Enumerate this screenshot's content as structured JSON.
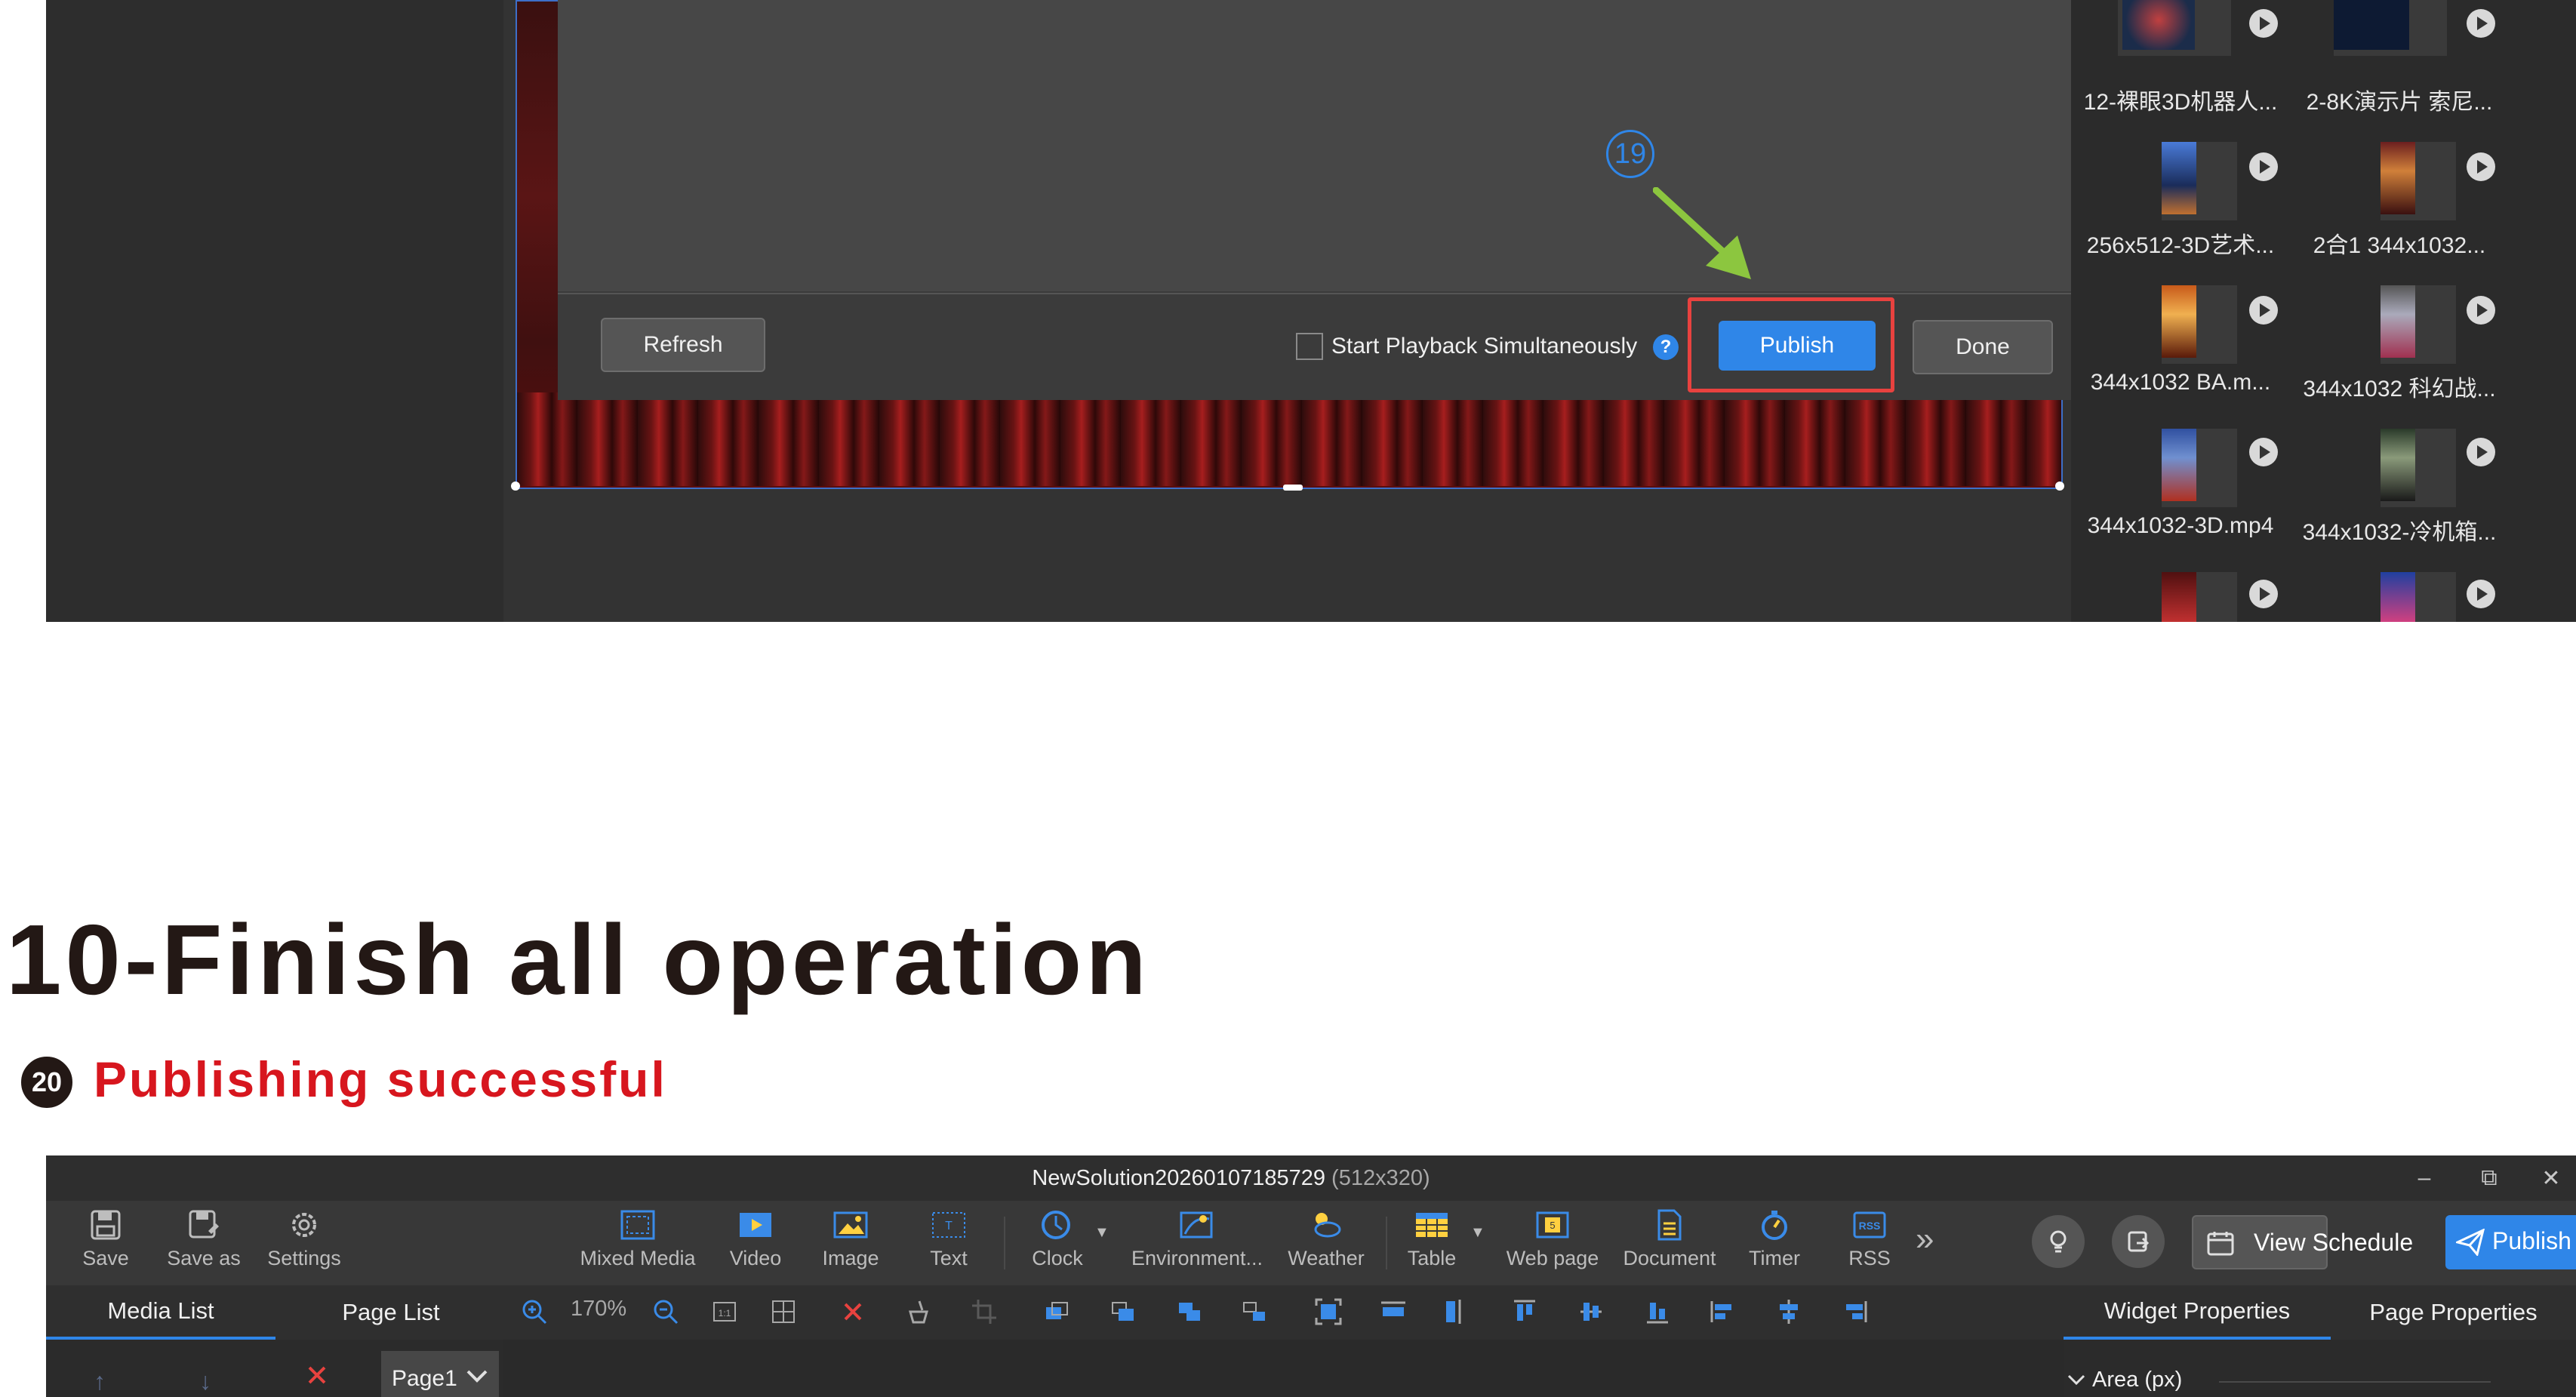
{
  "top_dialog": {
    "refresh_label": "Refresh",
    "start_playback_label": "Start Playback Simultaneously",
    "help_glyph": "?",
    "publish_label": "Publish",
    "done_label": "Done",
    "step_number": "19"
  },
  "media_grid": [
    {
      "caption": "12-裸眼3D机器人..."
    },
    {
      "caption": "2-8K演示片 索尼..."
    },
    {
      "caption": "256x512-3D艺术..."
    },
    {
      "caption": "2合1 344x1032..."
    },
    {
      "caption": "344x1032   BA.m..."
    },
    {
      "caption": "344x1032 科幻战..."
    },
    {
      "caption": "344x1032-3D.mp4"
    },
    {
      "caption": "344x1032-冷机箱..."
    }
  ],
  "heading": "10-Finish all operation",
  "step20": {
    "number": "20",
    "title": "Publishing successful"
  },
  "app": {
    "title": "NewSolution20260107185729",
    "resolution": "(512x320)",
    "window_controls": {
      "minimize": "–",
      "restore": "⧉",
      "close": "✕"
    },
    "toolbar": {
      "save": "Save",
      "save_as": "Save as",
      "settings": "Settings",
      "mixed_media": "Mixed Media",
      "video": "Video",
      "image": "Image",
      "text": "Text",
      "clock": "Clock",
      "environment": "Environment...",
      "weather": "Weather",
      "table": "Table",
      "web_page": "Web page",
      "document": "Document",
      "timer": "Timer",
      "rss": "RSS",
      "more": "»",
      "view_schedule": "View Schedule",
      "publish": "Publish"
    },
    "tabs": {
      "media_list": "Media List",
      "page_list": "Page List",
      "widget_properties": "Widget Properties",
      "page_properties": "Page Properties"
    },
    "zoom": "170%",
    "page_tab": "Page1",
    "area_label": "Area (px)",
    "colors": {
      "accent": "#2f86e8",
      "highlight": "#e8423f",
      "step_red": "#d7161e",
      "arrow_green": "#8cc63f"
    }
  }
}
